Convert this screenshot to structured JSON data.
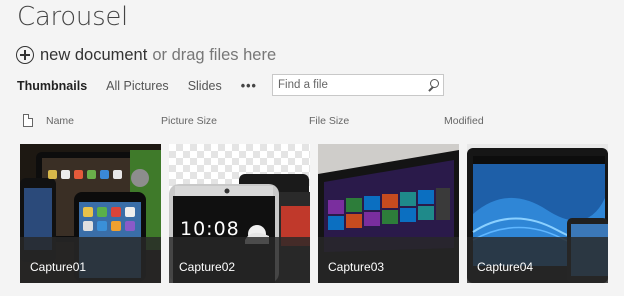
{
  "page": {
    "title": "Carousel"
  },
  "upload": {
    "new_document": "new document",
    "drag_hint": "or drag files here"
  },
  "views": {
    "tabs": [
      "Thumbnails",
      "All Pictures",
      "Slides"
    ],
    "active": "Thumbnails",
    "more": "•••"
  },
  "search": {
    "placeholder": "Find a file",
    "value": ""
  },
  "columns": [
    "Name",
    "Picture Size",
    "File Size",
    "Modified"
  ],
  "thumbnails": [
    {
      "name": "Capture01",
      "screen_text": []
    },
    {
      "name": "Capture02",
      "screen_text": [
        "10:08"
      ]
    },
    {
      "name": "Capture03",
      "screen_text": []
    },
    {
      "name": "Capture04",
      "screen_text": []
    }
  ],
  "colors": {
    "background": "#f4f4f4",
    "caption_overlay": "#282828",
    "win8_tiles": [
      "#7a2e9e",
      "#2d7d3a",
      "#0b6fc1",
      "#c64b1f",
      "#1f8a8a"
    ]
  }
}
